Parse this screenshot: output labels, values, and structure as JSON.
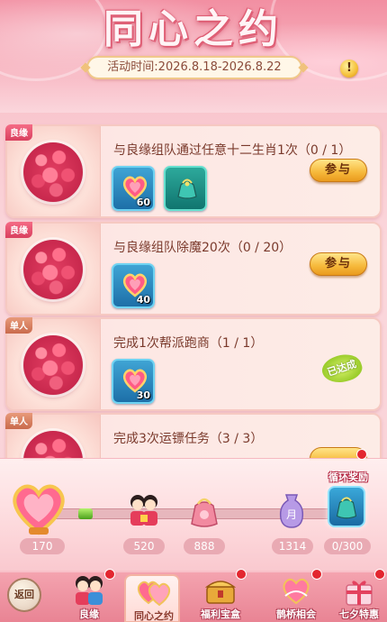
{
  "header": {
    "title": "同心之约",
    "time_label": "活动时间:2026.8.18-2026.8.22",
    "info_symbol": "!"
  },
  "tasks": [
    {
      "tag": "良缘",
      "desc": "与良缘组队通过任意十二生肖1次（0 / 1）",
      "rewards": [
        {
          "icon": "heart-gift-icon",
          "count": "60"
        },
        {
          "icon": "gift-bag-icon",
          "count": ""
        }
      ],
      "action": "参与",
      "state": "available"
    },
    {
      "tag": "良缘",
      "desc": "与良缘组队除魔20次（0 / 20）",
      "rewards": [
        {
          "icon": "heart-gift-icon",
          "count": "40"
        }
      ],
      "action": "参与",
      "state": "available"
    },
    {
      "tag": "单人",
      "desc": "完成1次帮派跑商（1 / 1）",
      "rewards": [
        {
          "icon": "heart-gift-icon",
          "count": "30"
        }
      ],
      "action": "已达成",
      "state": "done"
    },
    {
      "tag": "单人",
      "desc": "完成3次运镖任务（3 / 3）",
      "rewards": [],
      "action": "",
      "state": "done"
    }
  ],
  "progress": {
    "current": "170",
    "fraction_filled": 0.02,
    "milestones": [
      {
        "icon": "couple-icon",
        "value": "520"
      },
      {
        "icon": "pouch-icon",
        "value": "888"
      },
      {
        "icon": "vase-icon",
        "value": "1314"
      }
    ],
    "final_reward_label": "循环奖励",
    "final_reward_count": "0/300"
  },
  "nav": {
    "back_label": "返回",
    "items": [
      {
        "label": "良缘",
        "icon": "couple-icon",
        "active": false,
        "dot": true
      },
      {
        "label": "同心之约",
        "icon": "double-heart-icon",
        "active": true,
        "dot": false
      },
      {
        "label": "福利宝盒",
        "icon": "treasure-box-icon",
        "active": false,
        "dot": true
      },
      {
        "label": "鹊桥相会",
        "icon": "bridge-icon",
        "active": false,
        "dot": true
      },
      {
        "label": "七夕特惠",
        "icon": "gift-box-icon",
        "active": false,
        "dot": true
      }
    ]
  },
  "colors": {
    "accent": "#e3262f",
    "button": "#f6b83a",
    "reward_tile": "#1d6fa8"
  }
}
